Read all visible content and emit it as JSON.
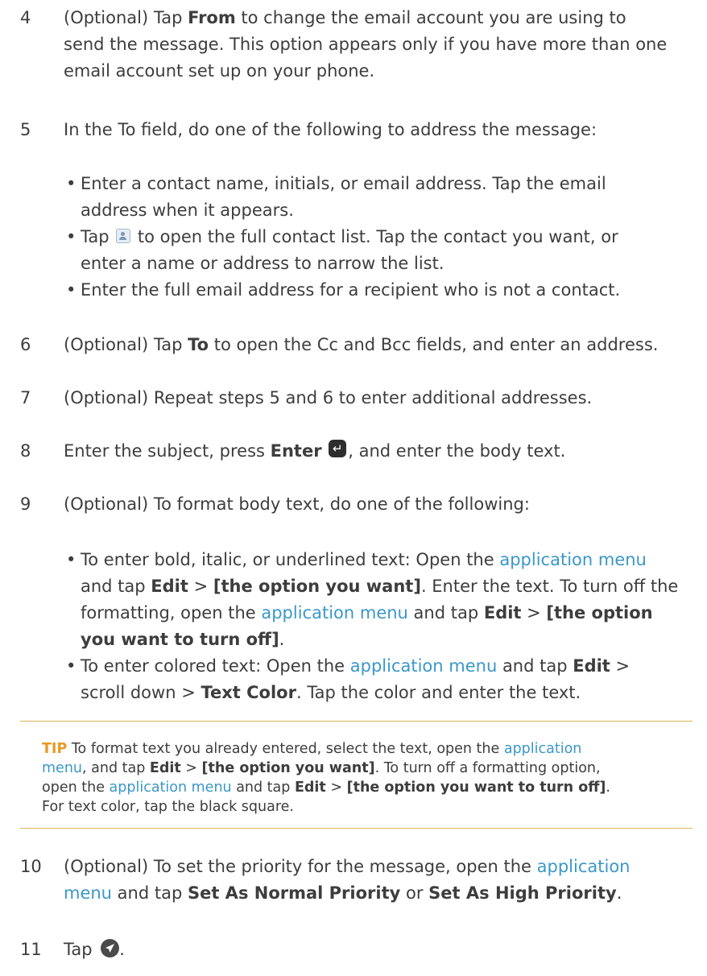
{
  "steps": {
    "s4": {
      "num": "4",
      "l1_a": "(Optional) Tap ",
      "l1_b": "From",
      "l1_c": " to change the email account you are using to",
      "l2": "send the message. This option appears only if you have more than one",
      "l3": "email account set up on your phone."
    },
    "s5": {
      "num": "5",
      "text": "In the To field, do one of the following to address the message:"
    },
    "b5_1": {
      "l1": "Enter a contact name, initials, or email address. Tap the email",
      "l2": "address when it appears."
    },
    "b5_2": {
      "l1_a": "Tap ",
      "l1_b": " to open the full contact list. Tap the contact you want, or",
      "l2": "enter a name or address to narrow the list."
    },
    "b5_3": {
      "l1": "Enter the full email address for a recipient who is not a contact."
    },
    "s6": {
      "num": "6",
      "a": "(Optional) Tap ",
      "b": "To",
      "c": " to open the Cc and Bcc fields, and enter an address."
    },
    "s7": {
      "num": "7",
      "text": "(Optional) Repeat steps 5 and 6 to enter additional addresses."
    },
    "s8": {
      "num": "8",
      "a": "Enter the subject, press ",
      "b": "Enter",
      "c": ", and enter the body text."
    },
    "s9": {
      "num": "9",
      "text": "(Optional) To format body text, do one of the following:"
    },
    "b9_1": {
      "l1_a": "To enter bold, italic, or underlined text: Open the ",
      "l1_link": "application menu",
      "l2_a": "and tap ",
      "l2_b": "Edit",
      "l2_c": " > ",
      "l2_d": "[the option you want]",
      "l2_e": ". Enter the text. To turn off the",
      "l3_a": "formatting, open the ",
      "l3_link": "application menu",
      "l3_b": " and tap ",
      "l3_c": "Edit",
      "l3_d": " > ",
      "l3_e": "[the option",
      "l4_a": "you want to turn off]",
      "l4_b": "."
    },
    "b9_2": {
      "l1_a": "To enter colored text: Open the ",
      "l1_link": "application menu",
      "l1_b": " and tap ",
      "l1_c": "Edit",
      "l1_d": " >",
      "l2_a": "scroll down > ",
      "l2_b": "Text Color",
      "l2_c": ". Tap the color and enter the text."
    },
    "s10": {
      "num": "10",
      "l1_a": "(Optional) To set the priority for the message, open the ",
      "l1_link": "application",
      "l2_link": "menu",
      "l2_a": " and tap ",
      "l2_b": "Set As Normal Priority",
      "l2_c": " or ",
      "l2_d": "Set As High Priority",
      "l2_e": "."
    },
    "s11": {
      "num": "11",
      "a": "Tap ",
      "b": "."
    }
  },
  "tip": {
    "label": "TIP",
    "l1_a": "  To format text you already entered, select the text, open the ",
    "l1_link": "application",
    "l2_link": "menu",
    "l2_a": ", and tap ",
    "l2_b": "Edit",
    "l2_c": " > ",
    "l2_d": "[the option you want]",
    "l2_e": ". To turn off a formatting option,",
    "l3_a": "open the ",
    "l3_link": "application menu",
    "l3_b": " and tap ",
    "l3_c": "Edit",
    "l3_d": " > ",
    "l3_e": "[the option you want to turn off]",
    "l3_f": ".",
    "l4": "For text color, tap the black square."
  },
  "bullet_glyph": "•",
  "colors": {
    "link": "#3b98c8",
    "tip_label": "#e79a22",
    "rule": "#d9b25a",
    "text": "#3d3d3d"
  },
  "icons": {
    "contact": "contact-card-icon",
    "enter": "enter-key-icon",
    "send": "send-icon"
  }
}
